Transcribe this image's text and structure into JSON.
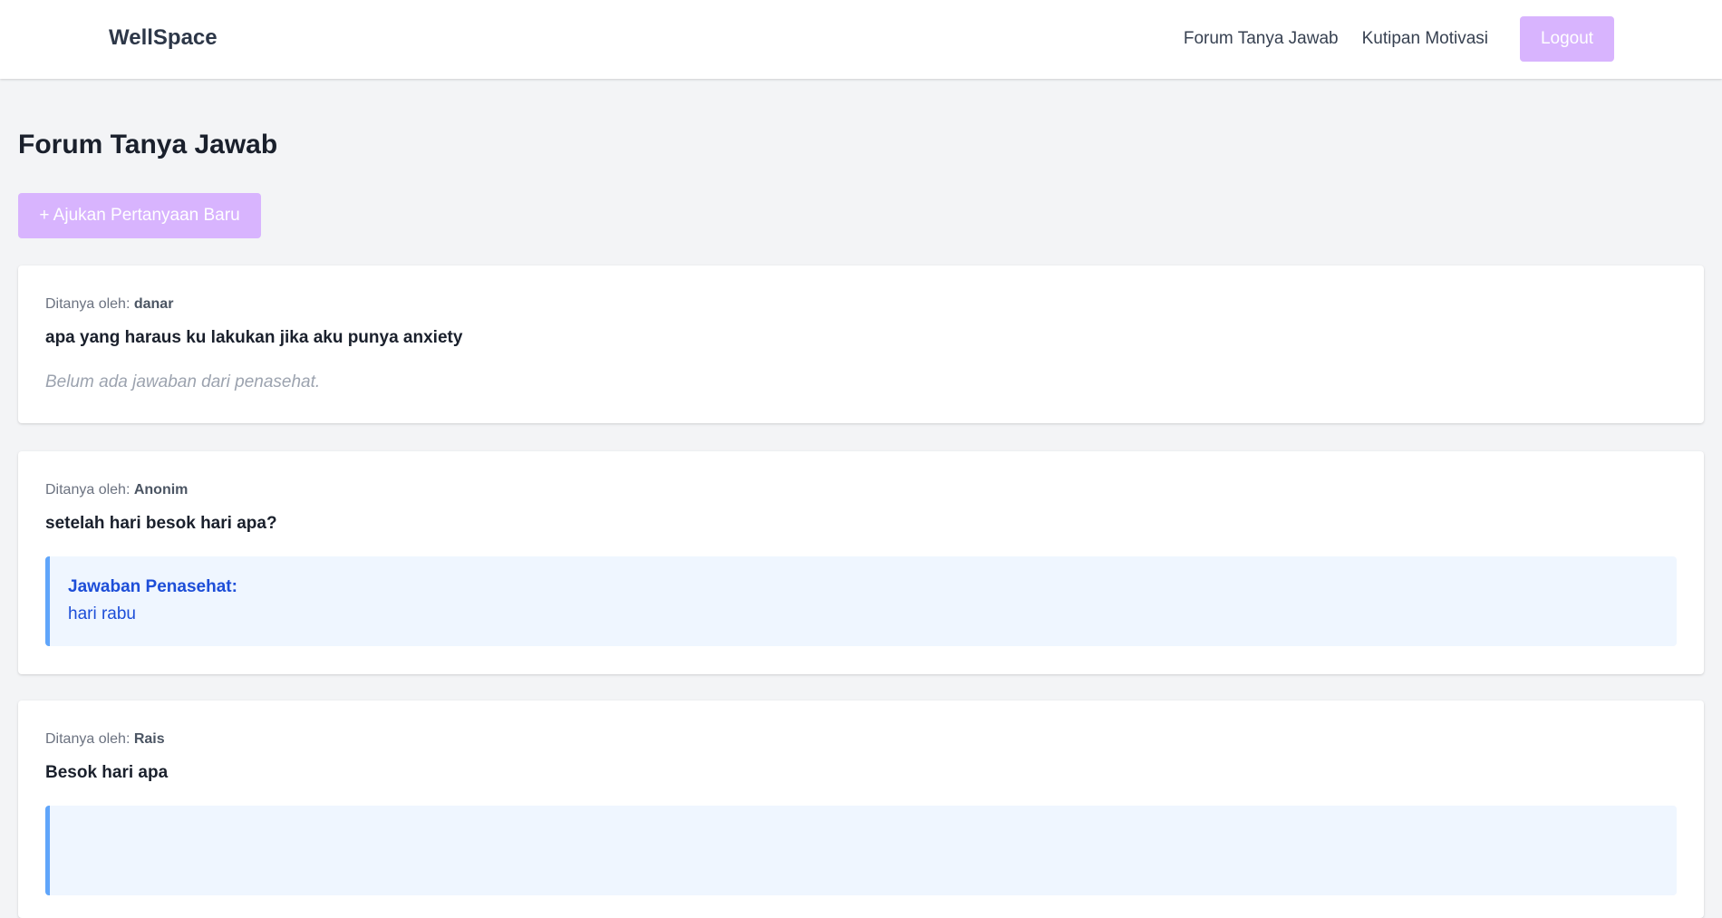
{
  "app": {
    "brand": "WellSpace"
  },
  "nav": {
    "links": [
      "Forum Tanya Jawab",
      "Kutipan Motivasi"
    ],
    "logout_label": "Logout"
  },
  "page": {
    "title": "Forum Tanya Jawab",
    "ask_button_label": "+ Ajukan Pertanyaan Baru",
    "asked_by_label": "Ditanya oleh:",
    "answer_heading": "Jawaban Penasehat:",
    "no_answer_text": "Belum ada jawaban dari penasehat."
  },
  "questions": [
    {
      "author": "danar",
      "question": "apa yang haraus ku lakukan jika aku punya anxiety",
      "answer": null
    },
    {
      "author": "Anonim",
      "question": "setelah hari besok hari apa?",
      "answer": "hari rabu"
    },
    {
      "author": "Rais",
      "question": "Besok hari apa",
      "answer": ""
    }
  ],
  "colors": {
    "accent": "#d8b4fe",
    "background": "#f3f4f6",
    "answer_bg": "#eff6ff",
    "answer_border": "#60a5fa",
    "answer_text": "#1d4ed8"
  }
}
